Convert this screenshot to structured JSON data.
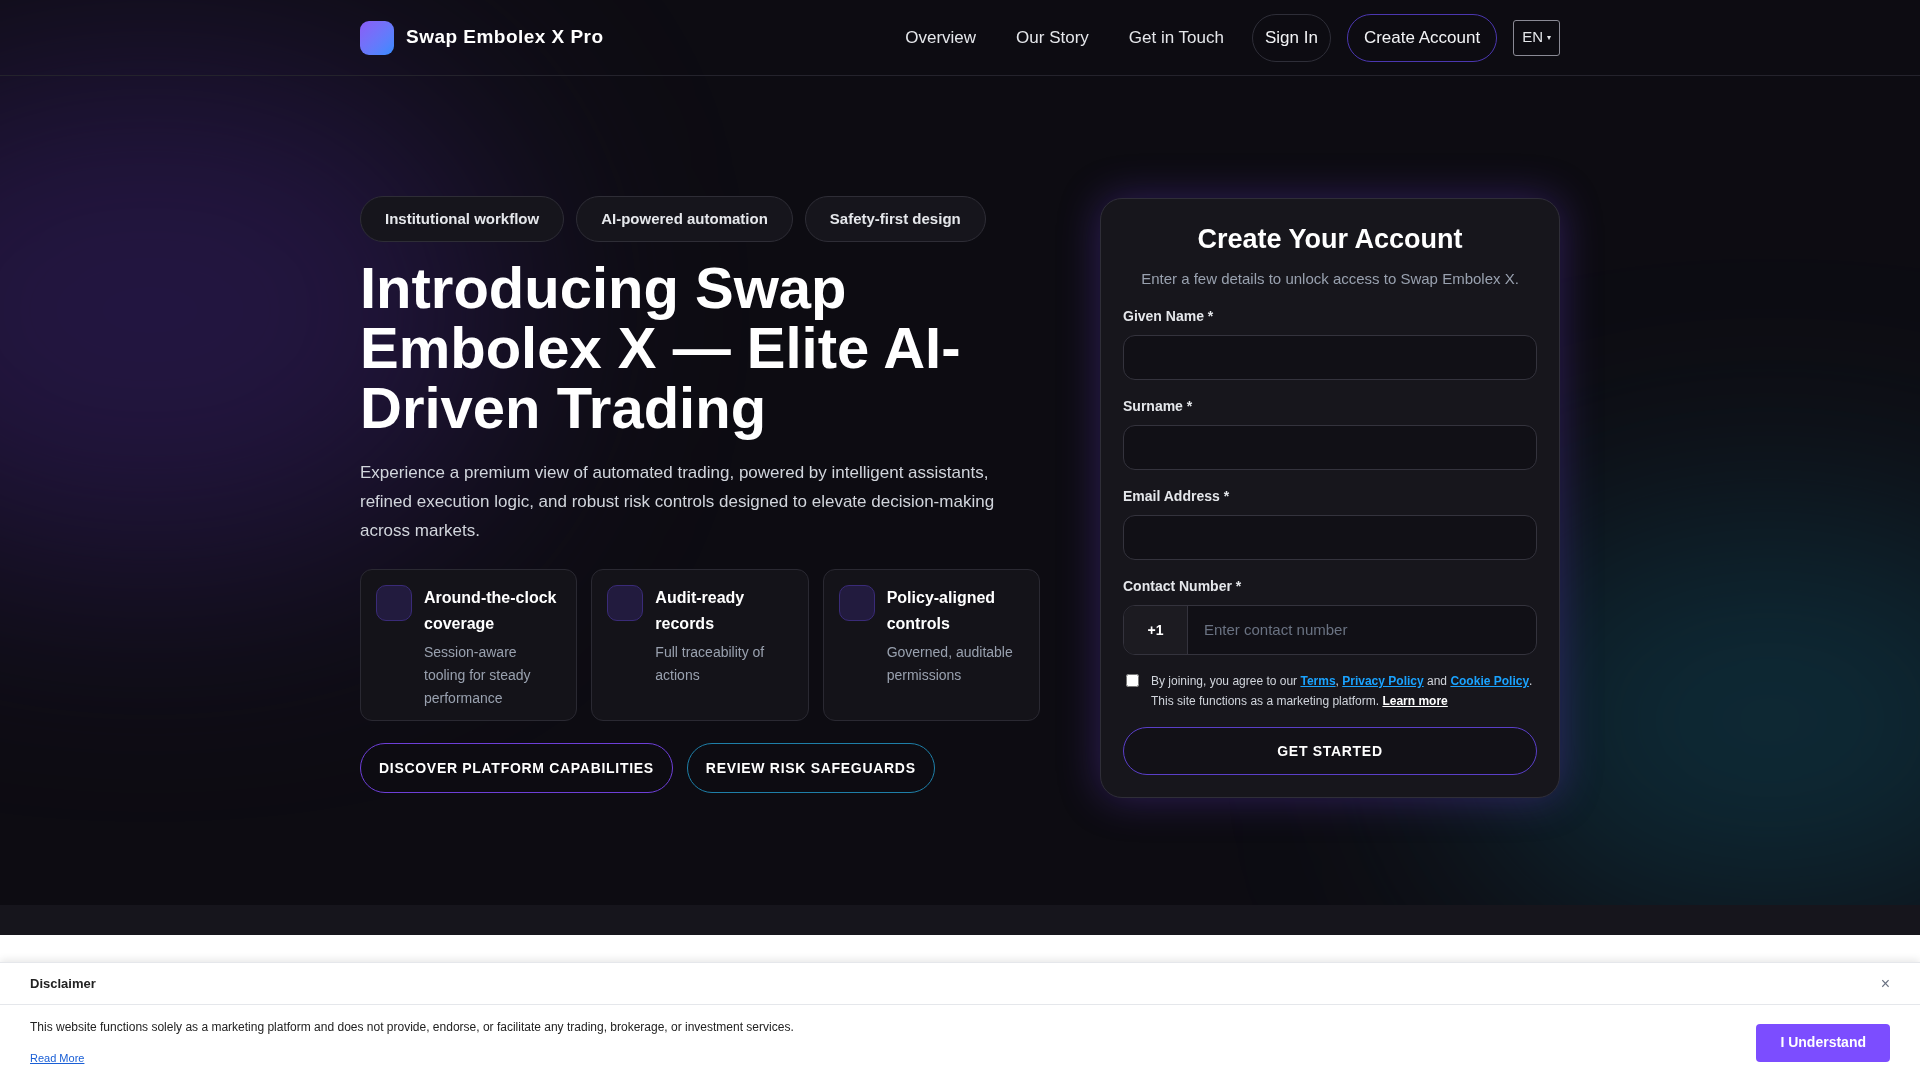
{
  "header": {
    "brand": "Swap Embolex X Pro",
    "nav": [
      {
        "label": "Overview",
        "kind": "link"
      },
      {
        "label": "Our Story",
        "kind": "link"
      },
      {
        "label": "Get in Touch",
        "kind": "link"
      },
      {
        "label": "Sign In",
        "kind": "outline"
      },
      {
        "label": "Create Account",
        "kind": "accent"
      }
    ],
    "language": "EN",
    "language_caret": "▾"
  },
  "hero": {
    "chips": [
      "Institutional workflow",
      "AI-powered automation",
      "Safety-first design"
    ],
    "title": "Introducing Swap Embolex X — Elite AI-Driven Trading",
    "lead": "Experience a premium view of automated trading, powered by intelligent assistants, refined execution logic, and robust risk controls designed to elevate decision-making across markets.",
    "features": [
      {
        "title": "Around-the-clock coverage",
        "text": "Session-aware tooling for steady performance"
      },
      {
        "title": "Audit-ready records",
        "text": "Full traceability of actions"
      },
      {
        "title": "Policy-aligned controls",
        "text": "Governed, auditable permissions"
      }
    ],
    "buttons": [
      {
        "label": "DISCOVER PLATFORM CAPABILITIES",
        "color": "#6d3fd8"
      },
      {
        "label": "REVIEW RISK SAFEGUARDS",
        "color": "#1e7fa8"
      }
    ]
  },
  "form": {
    "title": "Create Your Account",
    "subtitle": "Enter a few details to unlock access to Swap Embolex X.",
    "fields": [
      {
        "label": "Given Name *",
        "kind": "text"
      },
      {
        "label": "Surname *",
        "kind": "text"
      },
      {
        "label": "Email Address *",
        "kind": "text"
      },
      {
        "label": "Contact Number *",
        "kind": "phone",
        "prefix": "+1",
        "placeholder": "Enter contact number"
      }
    ],
    "consent": {
      "checked": false,
      "before": "By joining, you agree to our",
      "terms": "Terms",
      "comma": ",",
      "privacy": "Privacy Policy",
      "and": "and",
      "cookie": "Cookie Policy",
      "after": ". This site functions as a marketing platform.",
      "learn": "Learn more"
    },
    "submit": "GET STARTED"
  },
  "disclaimer": {
    "title": "Disclaimer",
    "close": "×",
    "text": "This website functions solely as a marketing platform and does not provide, endorse, or facilitate any trading, brokerage, or investment services.",
    "link": "Read More",
    "button": "I Understand"
  }
}
